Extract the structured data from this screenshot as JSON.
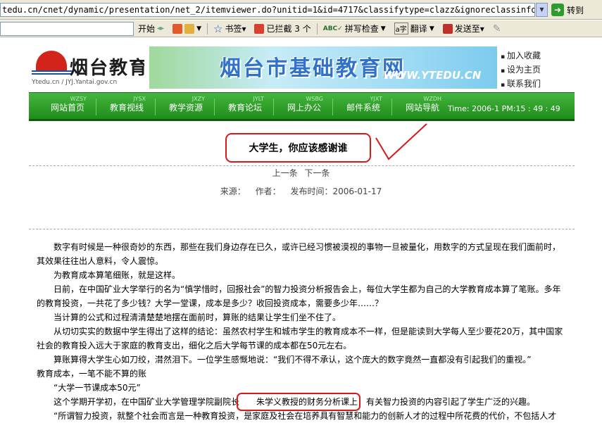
{
  "browser": {
    "address": "tedu.cn/cnet/dynamic/presentation/net_2/itemviewer.do?unitid=1&id=4717&classifytype=clazz&ignoreclassinformation=false&branch=",
    "go_label": "转到",
    "toolbar": {
      "start": "开始",
      "bookmarks": "书签▾",
      "blocked": "已拦截 3 个",
      "spellcheck": "拼写检查",
      "translate": "翻译",
      "sendto": "发送至▾"
    }
  },
  "site": {
    "logo_text": "烟台教育",
    "logo_sub": "Ytedu.cn / JYJ.Yantai.gov.cn",
    "banner_title": "烟台市基础教育网",
    "banner_url": "WWW.YTEDU.CN",
    "side_links": [
      "加入收藏",
      "设为主页",
      "联系我们"
    ]
  },
  "nav": {
    "items": [
      {
        "code": "WZSY",
        "label": "网站首页"
      },
      {
        "code": "JYSX",
        "label": "教育视线"
      },
      {
        "code": "JXZY",
        "label": "教学资源"
      },
      {
        "code": "JYLT",
        "label": "教育论坛"
      },
      {
        "code": "WSBG",
        "label": "网上办公"
      },
      {
        "code": "YJXT",
        "label": "邮件系统"
      },
      {
        "code": "WZDH",
        "label": "网站导航"
      }
    ],
    "time": "Time: 2006-1 PM:15 : 49 : 49"
  },
  "article": {
    "title": "大学生，你应该感谢谁",
    "prev": "上一条",
    "next": "下一条",
    "source_label": "来源：",
    "author_label": "作者：",
    "date_label": "发布时间：2006-01-17",
    "p1": "数字有时候是一种很奇妙的东西，那些在我们身边存在已久，或许已经习惯被漠视的事物一旦被量化，用数字的方式呈现在我们面前时，其效果往往出人意料，令人震惊。",
    "p2": "为教育成本算笔细账，就是这样。",
    "p3": "日前，在中国矿业大学举行的名为“慎学惜时，回报社会”的智力投资分析报告会上，每位大学生都为自己的大学教育成本算了笔账。多年的教育投资，一共花了多少钱？大学一堂课，成本是多少？收回投资成本，需要多少年……？",
    "p4": "当计算的公式和过程清清楚楚地摆在面前时，算账的结果让学生们坐不住了。",
    "p5": "从切切实实的数据中学生得出了这样的结论：虽然农村学生和城市学生的教育成本不一样，但是能读到大学每人至少要花20万，其中国家社会的教育投入远大于家庭的教育支出，细化之后大学每节课的成本都在50元左右。",
    "p6": "算账算得大学生心如刀绞，潸然泪下。一位学生感慨地说：“我们不得不承认，这个庞大的数字竟然一直都没有引起我们的重视。”",
    "p7": "教育成本，一笔不能不算的账",
    "p8": "“大学一节课成本50元”",
    "p9a": "这个学期开学初，在中国矿业大学管理学院副院长",
    "p9b": "朱学义教授的财务分析课上",
    "p9c": "，有关智力投资的内容引起了学生广泛的兴趣。",
    "p10": "“所谓智力投资，就整个社会而言是一种教育投资，是家庭及社会在培养具有智慧和能力的创新人才的过程中所花费的代价，不包括人才"
  }
}
